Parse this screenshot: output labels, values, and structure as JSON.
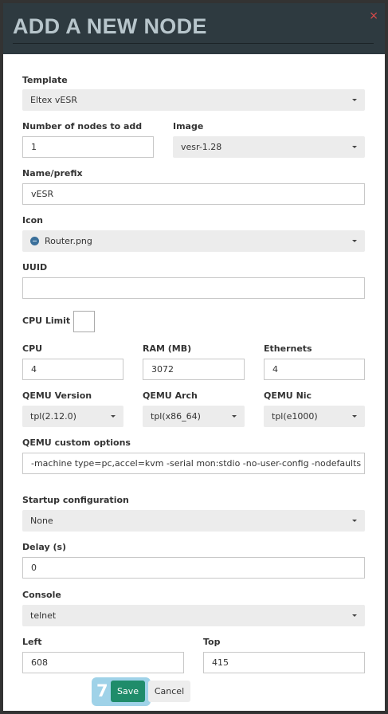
{
  "dialog": {
    "title": "ADD A NEW NODE",
    "close_symbol": "×"
  },
  "fields": {
    "template": {
      "label": "Template",
      "value": "Eltex vESR"
    },
    "nodes_count": {
      "label": "Number of nodes to add",
      "value": "1"
    },
    "image": {
      "label": "Image",
      "value": "vesr-1.28"
    },
    "name_prefix": {
      "label": "Name/prefix",
      "value": "vESR"
    },
    "icon": {
      "label": "Icon",
      "value": "Router.png"
    },
    "uuid": {
      "label": "UUID",
      "value": ""
    },
    "cpu_limit": {
      "label": "CPU Limit",
      "checked": false
    },
    "cpu": {
      "label": "CPU",
      "value": "4"
    },
    "ram": {
      "label": "RAM (MB)",
      "value": "3072"
    },
    "ethernets": {
      "label": "Ethernets",
      "value": "4"
    },
    "qemu_version": {
      "label": "QEMU Version",
      "value": "tpl(2.12.0)"
    },
    "qemu_arch": {
      "label": "QEMU Arch",
      "value": "tpl(x86_64)"
    },
    "qemu_nic": {
      "label": "QEMU Nic",
      "value": "tpl(e1000)"
    },
    "qemu_options": {
      "label": "QEMU custom options",
      "value": "-machine type=pc,accel=kvm -serial mon:stdio -no-user-config -nodefaults -rtc base=utc"
    },
    "startup_config": {
      "label": "Startup configuration",
      "value": "None"
    },
    "delay": {
      "label": "Delay (s)",
      "value": "0"
    },
    "console": {
      "label": "Console",
      "value": "telnet"
    },
    "left": {
      "label": "Left",
      "value": "608"
    },
    "top": {
      "label": "Top",
      "value": "415"
    }
  },
  "buttons": {
    "save": "Save",
    "cancel": "Cancel"
  },
  "step_badge": "7",
  "colors": {
    "header_bg": "#2e3a40",
    "save_bg": "#1f8c6a",
    "close": "#e04a4a",
    "badge": "#9fd2e8"
  }
}
